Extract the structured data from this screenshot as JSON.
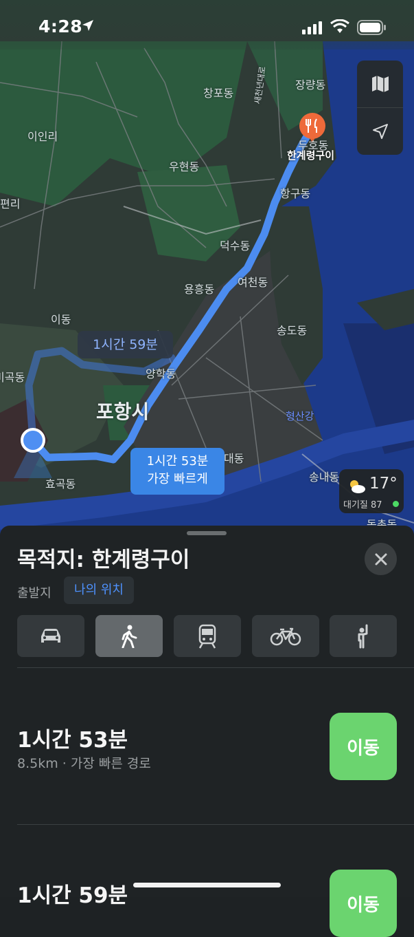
{
  "status_bar": {
    "time": "4:28"
  },
  "map": {
    "labels": {
      "changpo": "창포동",
      "yangdeok": "장량동",
      "iin": "이인리",
      "uhyeon": "우현동",
      "ri_left": "편리",
      "hanggu": "항구동",
      "deoksu": "덕수동",
      "yongheung": "용흥동",
      "yeocheon": "여천동",
      "idong": "이동",
      "songdo": "송도동",
      "yanghak": "양학동",
      "gok_left": "비곡동",
      "pohang": "포항시",
      "hyeongsan": "형산강",
      "daedong": "대동",
      "songnae": "송내동",
      "hyogok": "효곡동",
      "dongchon": "동촌동",
      "road_vertical": "새천년대로",
      "dudong": "두호동"
    },
    "poi": {
      "name": "한계령구이",
      "icon": "fork-knife-icon"
    },
    "callouts": {
      "alternate_time": "1시간 59분",
      "fastest_time": "1시간 53분",
      "fastest_label": "가장 빠르게"
    },
    "controls": [
      {
        "name": "map-mode",
        "icon": "map-icon"
      },
      {
        "name": "current-location",
        "icon": "location-arrow-icon"
      }
    ],
    "weather": {
      "temp": "17°",
      "air_quality_label": "대기질",
      "air_quality_value": "87",
      "icon": "partly-sunny-icon"
    }
  },
  "sheet": {
    "title": "목적지: 한계령구이",
    "origin_label": "출발지",
    "origin_value": "나의 위치",
    "modes": [
      {
        "name": "drive",
        "icon": "car-icon",
        "active": false
      },
      {
        "name": "walk",
        "icon": "walking-icon",
        "active": true
      },
      {
        "name": "transit",
        "icon": "train-icon",
        "active": false
      },
      {
        "name": "cycle",
        "icon": "bicycle-icon",
        "active": false
      },
      {
        "name": "ride",
        "icon": "hailing-person-icon",
        "active": false
      }
    ],
    "routes": [
      {
        "time": "1시간 53분",
        "detail": "8.5km · 가장 빠른 경로",
        "go_label": "이동"
      },
      {
        "time": "1시간 59분",
        "detail": "",
        "go_label": "이동"
      }
    ]
  },
  "colors": {
    "route": "#3a86e6",
    "go_button": "#6bd46f",
    "water": "#1c3a8a",
    "accent_link": "#4e92ff"
  }
}
